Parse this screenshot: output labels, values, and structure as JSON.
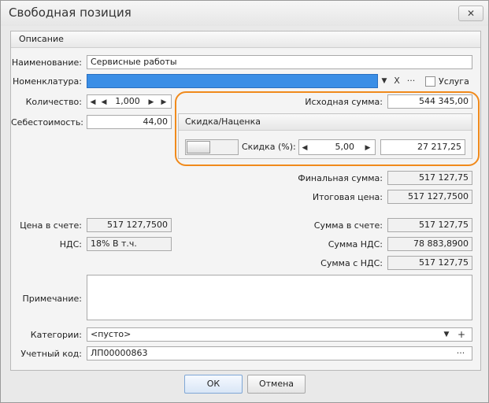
{
  "window": {
    "title": "Свободная позиция",
    "close_label": "✕"
  },
  "group": {
    "title": "Описание"
  },
  "name": {
    "label": "Наименование:",
    "value": "Сервисные работы"
  },
  "nomenclature": {
    "label": "Номенклатура:",
    "value": "",
    "clear_label": "X",
    "more_label": "···"
  },
  "service": {
    "label": "Услуга",
    "checked": false
  },
  "quantity": {
    "label": "Количество:",
    "value": "1,000"
  },
  "cost": {
    "label": "Себестоимость:",
    "value": "44,00"
  },
  "source_sum": {
    "label": "Исходная сумма:",
    "value": "544 345,00"
  },
  "discount_panel": {
    "title": "Скидка/Наценка",
    "label": "Скидка (%):",
    "percent": "5,00",
    "amount": "27 217,25"
  },
  "final_sum": {
    "label": "Финальная сумма:",
    "value": "517 127,75"
  },
  "total_price": {
    "label": "Итоговая цена:",
    "value": "517 127,7500"
  },
  "invoice_price": {
    "label": "Цена в счете:",
    "value": "517 127,7500"
  },
  "invoice_sum": {
    "label": "Сумма в счете:",
    "value": "517 127,75"
  },
  "vat": {
    "label": "НДС:",
    "value": "18% В т.ч."
  },
  "vat_sum": {
    "label": "Сумма НДС:",
    "value": "78 883,8900"
  },
  "sum_with_vat": {
    "label": "Сумма с НДС:",
    "value": "517 127,75"
  },
  "note": {
    "label": "Примечание:",
    "value": ""
  },
  "categories": {
    "label": "Категории:",
    "value": "<пусто>",
    "add_label": "+"
  },
  "account_code": {
    "label": "Учетный код:",
    "value": "ЛП00000863",
    "more_label": "···"
  },
  "buttons": {
    "ok": "ОК",
    "cancel": "Отмена"
  },
  "icons": {
    "dropdown": "▼",
    "left": "◀",
    "right": "▶"
  },
  "colors": {
    "selection": "#3a8ee6",
    "highlight": "#f08a1c"
  }
}
